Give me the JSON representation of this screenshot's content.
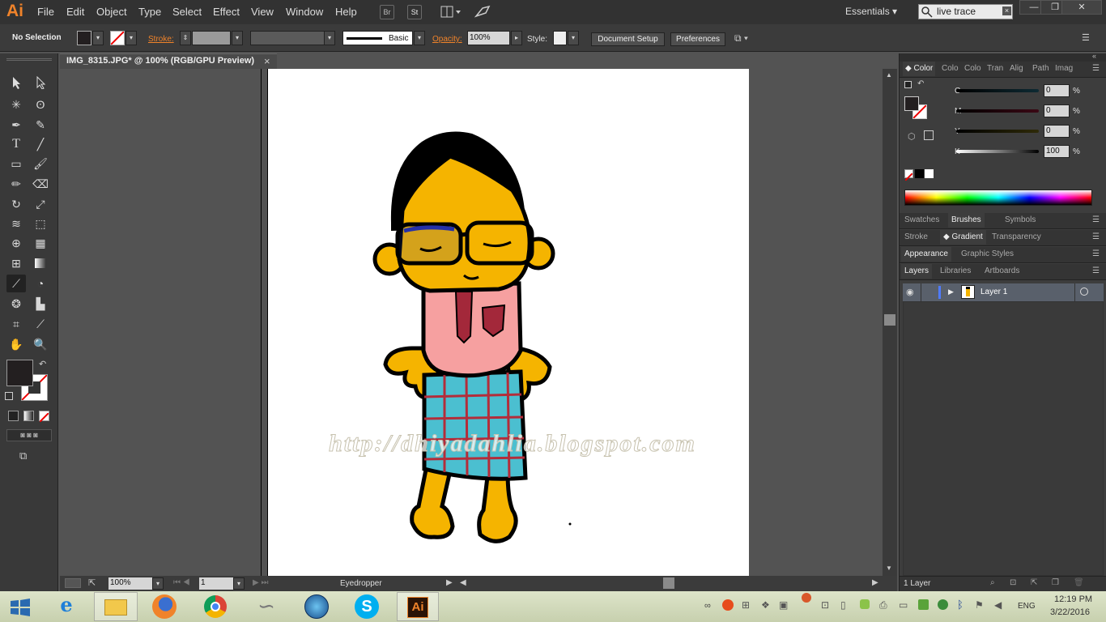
{
  "app": {
    "logo": "Ai"
  },
  "menu": [
    "File",
    "Edit",
    "Object",
    "Type",
    "Select",
    "Effect",
    "View",
    "Window",
    "Help"
  ],
  "menu_buttons": {
    "bridge": "Br",
    "stock": "St"
  },
  "workspace": "Essentials",
  "search": {
    "value": "live trace"
  },
  "control": {
    "selection": "No Selection",
    "stroke_label": "Stroke:",
    "brush": "Basic",
    "opacity_label": "Opacity:",
    "opacity_value": "100%",
    "style_label": "Style:",
    "document_setup": "Document Setup",
    "preferences": "Preferences"
  },
  "document": {
    "tab_title": "IMG_8315.JPG* @ 100% (RGB/GPU Preview)",
    "close": "×",
    "watermark": "http://dhiyadahlia.blogspot.com"
  },
  "statusbar": {
    "zoom": "100%",
    "artboard": "1",
    "tool": "Eyedropper"
  },
  "color_panel": {
    "tabs": [
      "Color",
      "Colo",
      "Colo",
      "Tran",
      "Alig",
      "Path",
      "Imag"
    ],
    "channels": [
      {
        "label": "C",
        "value": "0",
        "unit": "%"
      },
      {
        "label": "M",
        "value": "0",
        "unit": "%"
      },
      {
        "label": "Y",
        "value": "0",
        "unit": "%"
      },
      {
        "label": "K",
        "value": "100",
        "unit": "%"
      }
    ]
  },
  "panel_groups": [
    [
      "Swatches",
      "Brushes",
      "Symbols"
    ],
    [
      "Stroke",
      "Gradient",
      "Transparency"
    ],
    [
      "Appearance",
      "Graphic Styles"
    ],
    [
      "Layers",
      "Libraries",
      "Artboards"
    ]
  ],
  "layers": {
    "items": [
      {
        "name": "Layer 1"
      }
    ],
    "count": "1 Layer"
  },
  "taskbar": {
    "language": "ENG",
    "time": "12:19 PM",
    "date": "3/22/2016"
  },
  "colors": {
    "accent": "#f0832a",
    "panel": "#3d3d3d",
    "canvas": "#535353",
    "skin": "#f5b400",
    "shirt": "#f6a0a0",
    "sarong": "#4bbfd0"
  }
}
